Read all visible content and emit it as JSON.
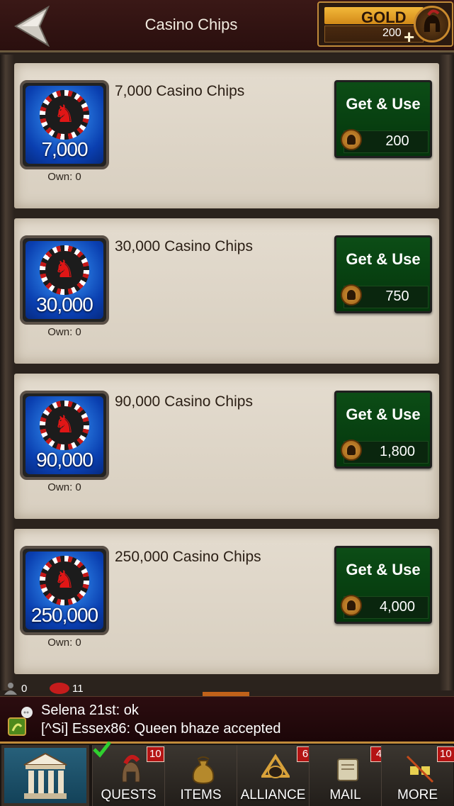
{
  "header": {
    "title": "Casino Chips",
    "gold_label": "GOLD",
    "gold_value": "200",
    "gold_plus": "+"
  },
  "items": [
    {
      "name": "7,000 Casino Chips",
      "chip_label": "7,000",
      "own": "Own: 0",
      "button": "Get & Use",
      "price": "200"
    },
    {
      "name": "30,000 Casino Chips",
      "chip_label": "30,000",
      "own": "Own: 0",
      "button": "Get & Use",
      "price": "750"
    },
    {
      "name": "90,000 Casino Chips",
      "chip_label": "90,000",
      "own": "Own: 0",
      "button": "Get & Use",
      "price": "1,800"
    },
    {
      "name": "250,000 Casino Chips",
      "chip_label": "250,000",
      "own": "Own: 0",
      "button": "Get & Use",
      "price": "4,000"
    }
  ],
  "status": {
    "players": "0",
    "messages": "11"
  },
  "chat": {
    "lines": [
      "Selena 21st: ok",
      "[^Si] Essex86: Queen bhaze accepted"
    ]
  },
  "nav": {
    "items": [
      {
        "label": "QUESTS",
        "badge": "10"
      },
      {
        "label": "ITEMS",
        "badge": ""
      },
      {
        "label": "ALLIANCE",
        "badge": "6"
      },
      {
        "label": "MAIL",
        "badge": "4"
      },
      {
        "label": "MORE",
        "badge": "10"
      }
    ]
  },
  "colors": {
    "header_bg": "#2a0f0e",
    "card_bg": "#e0d7c9",
    "button_green": "#0c4d16",
    "badge_red": "#b41414",
    "gold": "#f3b83a"
  }
}
